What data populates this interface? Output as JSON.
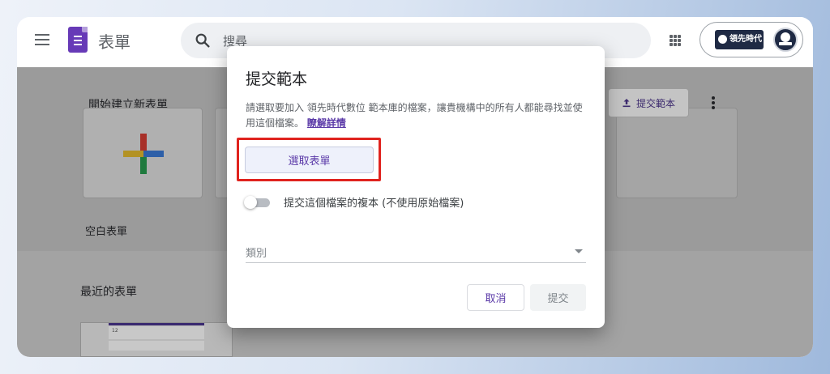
{
  "app": {
    "title": "表單",
    "brand_text": "領先時代"
  },
  "search": {
    "placeholder": "搜尋"
  },
  "templates": {
    "section_title": "開始建立新表單",
    "blank_label": "空白表單",
    "submit_template_label": "提交範本"
  },
  "recent": {
    "section_title": "最近的表單",
    "thumb_number": "12"
  },
  "dialog": {
    "title": "提交範本",
    "description": "請選取要加入 領先時代數位 範本庫的檔案，讓貴機構中的所有人都能尋找並使用這個檔案。",
    "learn_more": "瞭解詳情",
    "choose_form": "選取表單",
    "copy_toggle_label": "提交這個檔案的複本 (不使用原始檔案)",
    "copy_toggle_on": false,
    "category_label": "類別",
    "cancel": "取消",
    "submit": "提交"
  },
  "colors": {
    "accent": "#5b3aa8",
    "highlight": "#e0231e",
    "forms_purple": "#673ab7"
  }
}
